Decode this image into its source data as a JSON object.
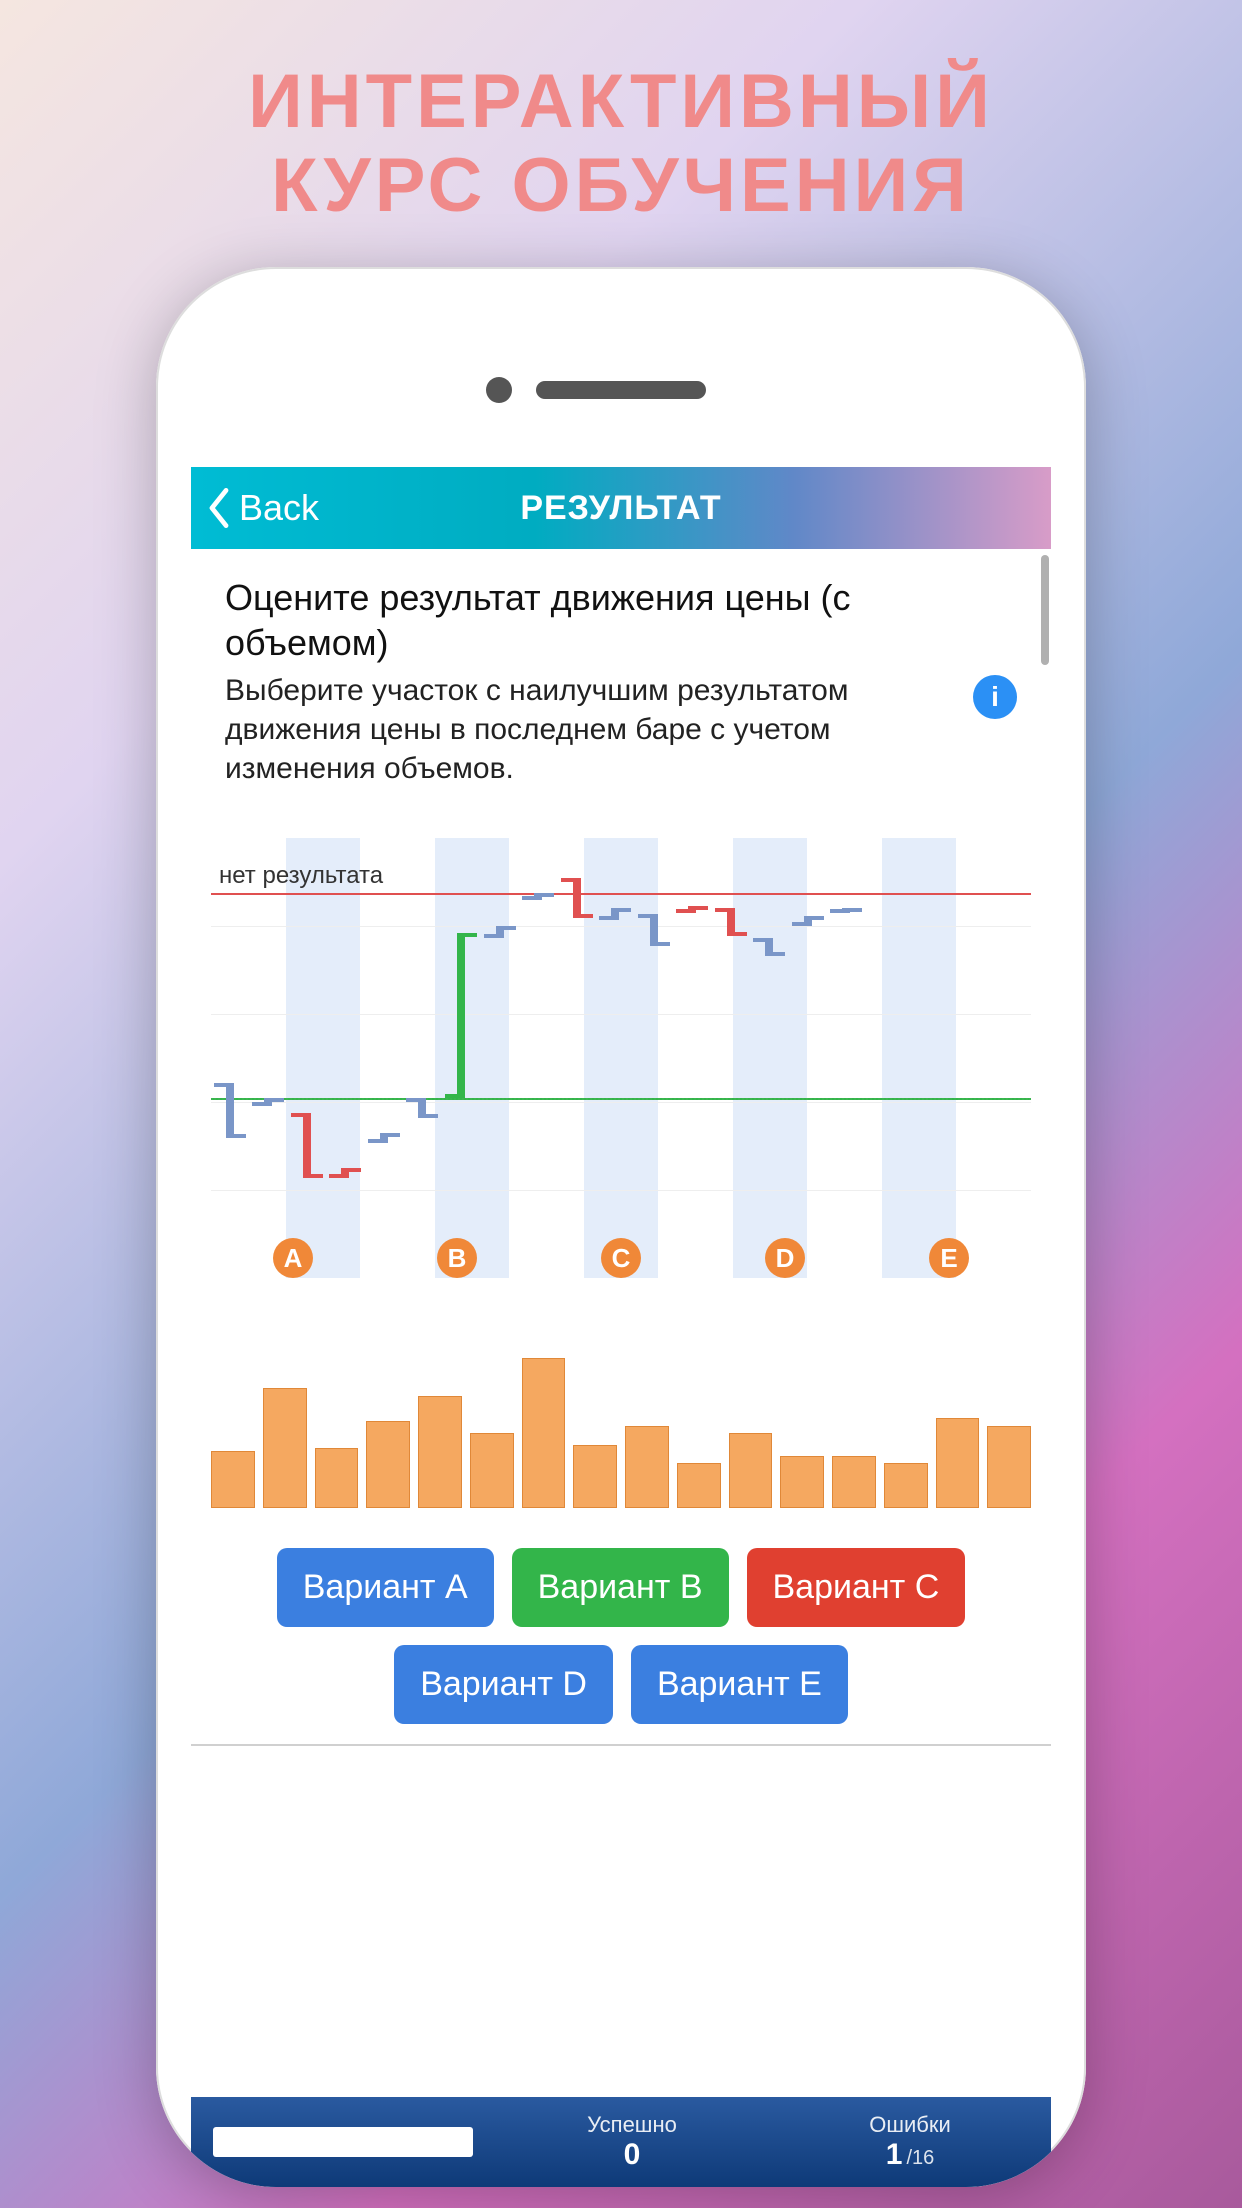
{
  "promo": {
    "line1": "ИНТЕРАКТИВНЫЙ",
    "line2": "КУРС ОБУЧЕНИЯ"
  },
  "nav": {
    "back": "Back",
    "title": "РЕЗУЛЬТАТ"
  },
  "question": {
    "title": "Оцените результат движения цены (с объемом)",
    "subtitle": "Выберите участок с наилучшим результатом движения цены в последнем баре с учетом изменения объемов.",
    "info_icon": "i"
  },
  "chart": {
    "no_result_label": "нет результата",
    "section_labels": [
      "A",
      "B",
      "C",
      "D",
      "E"
    ]
  },
  "chart_data": {
    "type": "bar",
    "title": "Volume",
    "categories": [
      "1",
      "2",
      "3",
      "4",
      "5",
      "6",
      "7",
      "8",
      "9",
      "10",
      "11",
      "12",
      "13",
      "14",
      "15",
      "16"
    ],
    "values": [
      38,
      80,
      40,
      58,
      75,
      50,
      100,
      42,
      55,
      30,
      50,
      35,
      35,
      30,
      60,
      55
    ],
    "xlabel": "",
    "ylabel": "",
    "ylim": [
      0,
      100
    ]
  },
  "options": [
    {
      "label": "Вариант A",
      "color": "c-blue"
    },
    {
      "label": "Вариант B",
      "color": "c-green"
    },
    {
      "label": "Вариант C",
      "color": "c-red"
    },
    {
      "label": "Вариант D",
      "color": "c-blue"
    },
    {
      "label": "Вариант E",
      "color": "c-blue"
    }
  ],
  "footer": {
    "success_label": "Успешно",
    "success_value": "0",
    "errors_label": "Ошибки",
    "errors_value": "1",
    "errors_total": "/16"
  },
  "candles": [
    {
      "x": 1.8,
      "open": 245,
      "close": 300,
      "color": "blue"
    },
    {
      "x": 6.5,
      "open": 268,
      "close": 260,
      "color": "blue"
    },
    {
      "x": 11.2,
      "open": 275,
      "close": 340,
      "color": "red"
    },
    {
      "x": 15.9,
      "open": 340,
      "close": 330,
      "color": "red"
    },
    {
      "x": 20.6,
      "open": 305,
      "close": 295,
      "color": "blue"
    },
    {
      "x": 25.3,
      "open": 260,
      "close": 280,
      "color": "blue"
    },
    {
      "x": 30.0,
      "open": 260,
      "close": 95,
      "color": "green"
    },
    {
      "x": 34.7,
      "open": 100,
      "close": 88,
      "color": "blue"
    },
    {
      "x": 39.4,
      "open": 62,
      "close": 55,
      "color": "blue"
    },
    {
      "x": 44.1,
      "open": 40,
      "close": 80,
      "color": "red"
    },
    {
      "x": 48.8,
      "open": 82,
      "close": 70,
      "color": "blue"
    },
    {
      "x": 53.5,
      "open": 76,
      "close": 108,
      "color": "blue"
    },
    {
      "x": 58.2,
      "open": 75,
      "close": 68,
      "color": "red"
    },
    {
      "x": 62.9,
      "open": 70,
      "close": 98,
      "color": "red"
    },
    {
      "x": 67.6,
      "open": 100,
      "close": 118,
      "color": "blue"
    },
    {
      "x": 72.3,
      "open": 88,
      "close": 78,
      "color": "blue"
    },
    {
      "x": 77.0,
      "open": 75,
      "close": 70,
      "color": "blue"
    }
  ],
  "ref_lines": {
    "red_y": 55,
    "green_y": 260
  }
}
